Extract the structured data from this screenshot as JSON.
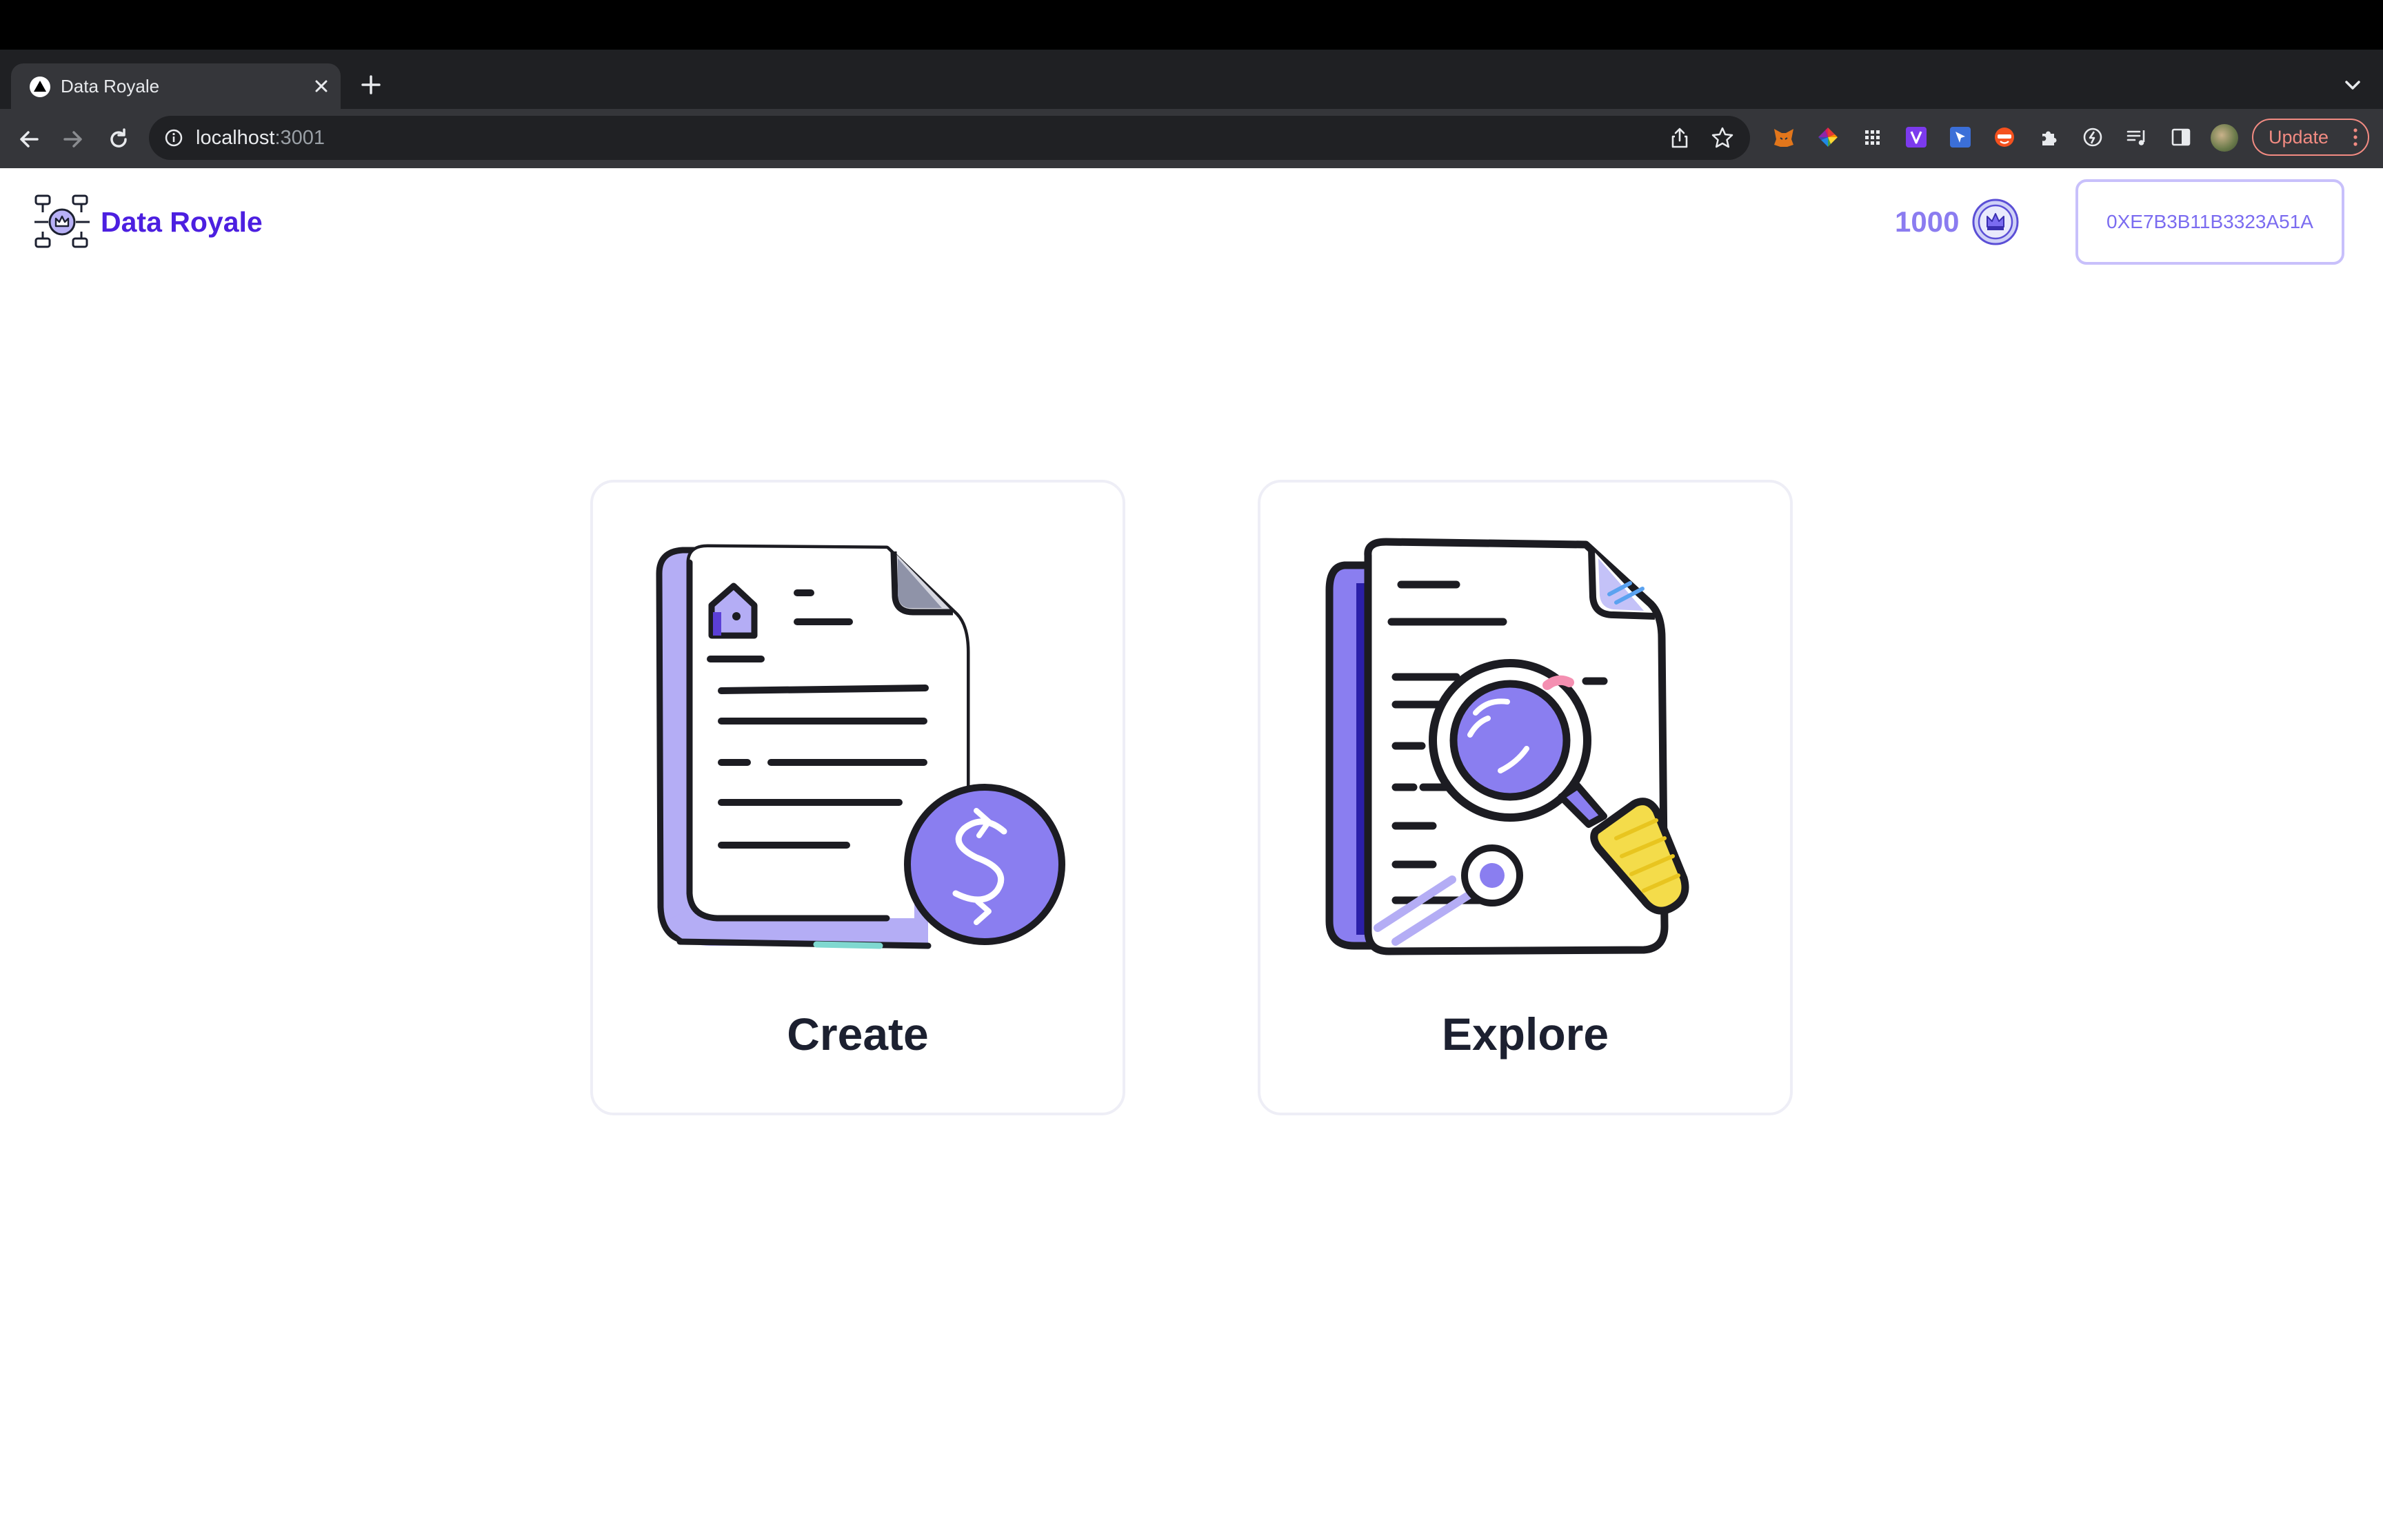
{
  "browser": {
    "tab_title": "Data Royale",
    "url_host": "localhost",
    "url_port": ":3001",
    "update_label": "Update"
  },
  "header": {
    "app_title": "Data Royale",
    "balance": "1000",
    "wallet_address": "0XE7B3B11B3323A51A"
  },
  "cards": [
    {
      "label": "Create",
      "icon": "document-dollar-icon"
    },
    {
      "label": "Explore",
      "icon": "document-search-icon"
    }
  ],
  "colors": {
    "brand": "#4c1fe0",
    "accent": "#8b7cf0",
    "card_border": "#eeeef6",
    "text_dark": "#1c2030"
  }
}
